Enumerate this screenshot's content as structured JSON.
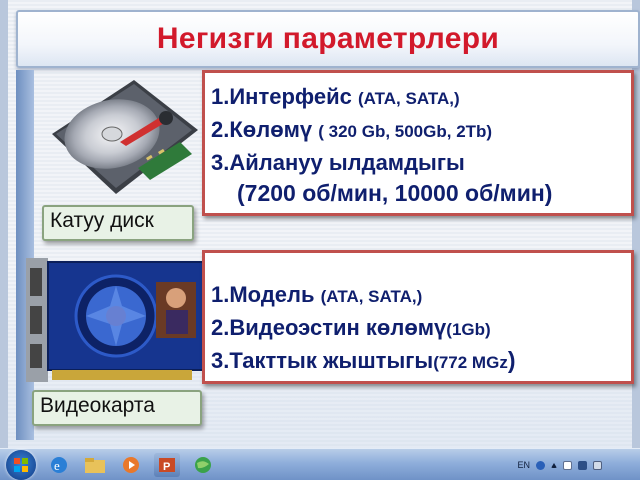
{
  "slide": {
    "title": "Негизги параметрлери",
    "hdd_label": "Катуу диск",
    "gpu_label": "Видеокарта",
    "hdd_params": {
      "row1_main": "1.Интерфейс ",
      "row1_detail": "(ATA, SATA,)",
      "row2_main": "2.Көлөмү ",
      "row2_detail": "( 320 Gb, 500Gb, 2Tb)",
      "row3_main": "3.Айлануу ылдамдыгы",
      "row4": "(7200 об/мин, 10000 об/мин)"
    },
    "gpu_params": {
      "row1_main": "1.Модель ",
      "row1_detail": "(ATA, SATA,)",
      "row2_main": "2.Видеоэстин көлөмү",
      "row2_detail": "(1Gb)",
      "row3_main": "3.Такттык жыштыгы",
      "row3_detail": "(772 MGz",
      "row3_close": ")"
    }
  },
  "taskbar": {
    "tray_lang": "EN"
  },
  "colors": {
    "title": "#d2192b",
    "text": "#0f1f6e",
    "box_border": "#c0504d",
    "label_bg": "#e8f2e6"
  },
  "icons": [
    "windows-start-icon",
    "ie-icon",
    "folder-icon",
    "media-player-icon",
    "powerpoint-icon",
    "globe-icon"
  ]
}
